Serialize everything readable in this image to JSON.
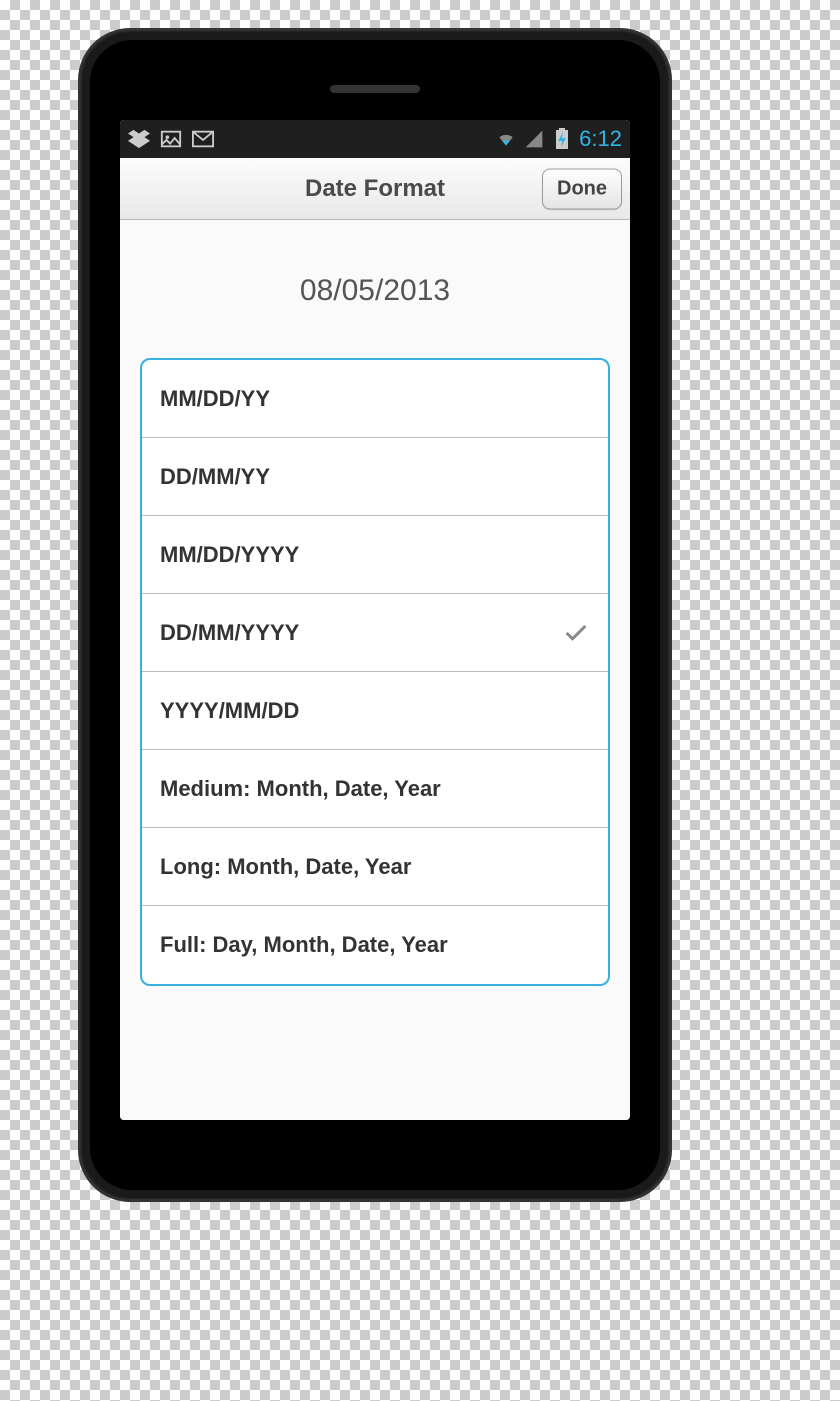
{
  "statusbar": {
    "time": "6:12",
    "icons_left": [
      "dropbox-icon",
      "gallery-icon",
      "gmail-icon"
    ],
    "icons_right": [
      "wifi-icon",
      "signal-icon",
      "battery-icon"
    ]
  },
  "toolbar": {
    "title": "Date Format",
    "done_label": "Done"
  },
  "preview": {
    "date_text": "08/05/2013"
  },
  "options": [
    {
      "label": "MM/DD/YY",
      "selected": false
    },
    {
      "label": "DD/MM/YY",
      "selected": false
    },
    {
      "label": "MM/DD/YYYY",
      "selected": false
    },
    {
      "label": "DD/MM/YYYY",
      "selected": true
    },
    {
      "label": "YYYY/MM/DD",
      "selected": false
    },
    {
      "label": "Medium: Month, Date, Year",
      "selected": false
    },
    {
      "label": "Long: Month, Date, Year",
      "selected": false
    },
    {
      "label": "Full: Day, Month, Date, Year",
      "selected": false
    }
  ],
  "colors": {
    "accent": "#33b5e5",
    "list_border": "#36b0dc",
    "toolbar_bg_top": "#fcfcfc",
    "toolbar_bg_bottom": "#e8e8e8"
  }
}
